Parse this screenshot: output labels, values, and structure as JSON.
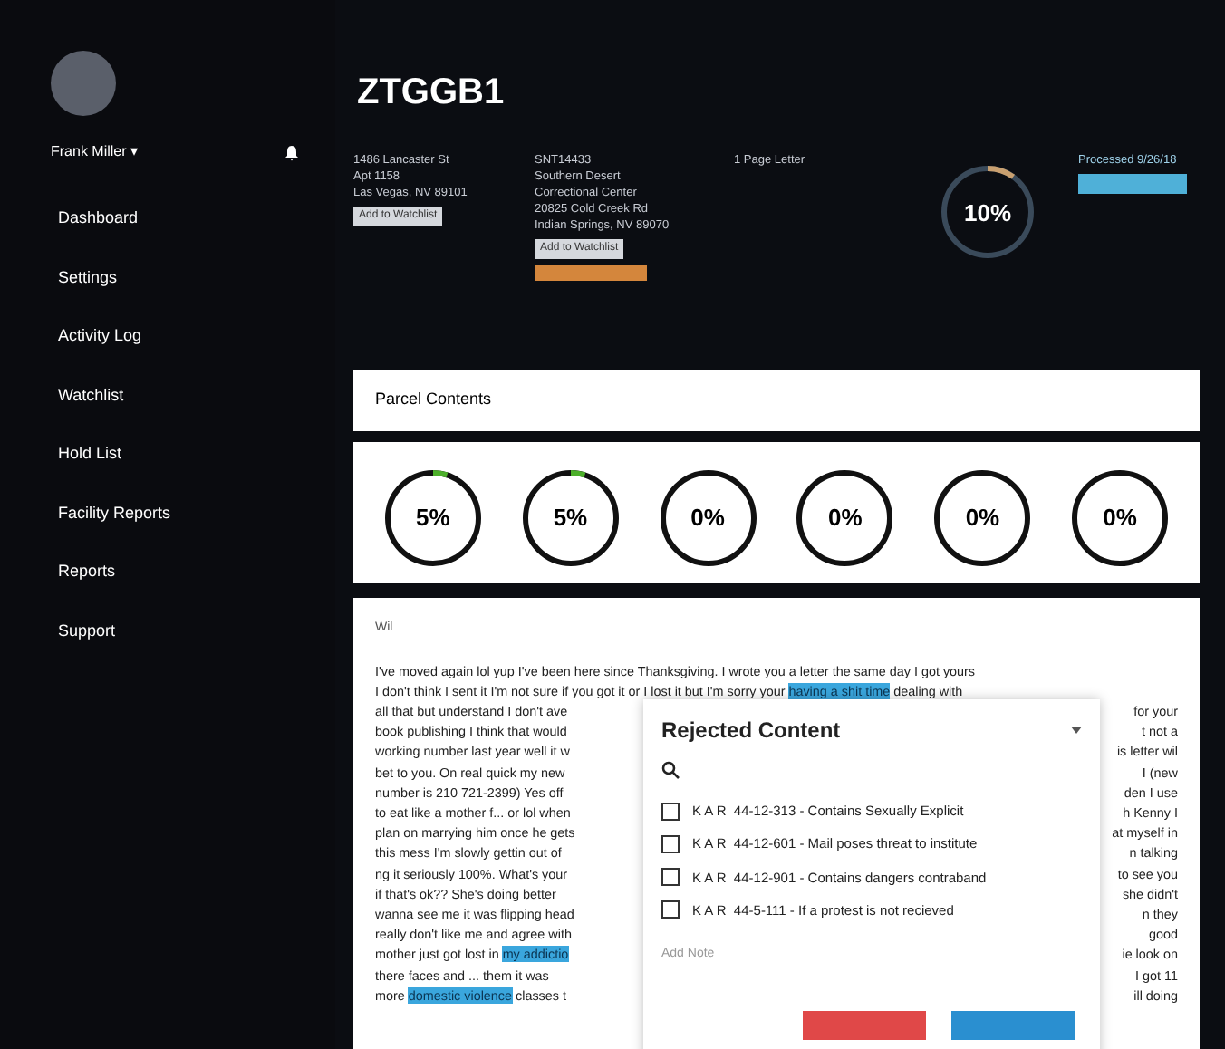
{
  "sidebar": {
    "user": "Frank Miller",
    "user_caret": "▾",
    "items": [
      {
        "label": "Dashboard",
        "selected": false
      },
      {
        "label": "Settings",
        "selected": false
      },
      {
        "label": "Activity Log",
        "selected": false
      },
      {
        "label": "Watchlist",
        "selected": false
      },
      {
        "label": "Hold List",
        "selected": false
      },
      {
        "label": "Facility Reports",
        "selected": false
      },
      {
        "label": "Reports",
        "selected": false
      },
      {
        "label": "Support",
        "selected": false
      }
    ]
  },
  "header": {
    "title": "ZTGGB1",
    "sender": {
      "lines": [
        "1486 Lancaster St",
        "Apt 1158",
        "Las Vegas, NV 89101"
      ],
      "button": "Add to Watchlist"
    },
    "recipient": {
      "lines": [
        "SNT14433",
        "Southern Desert",
        "Correctional Center",
        "20825 Cold Creek Rd",
        "Indian Springs, NV 89070"
      ],
      "button": "Add to Watchlist"
    },
    "category": "1 Page Letter",
    "threat": {
      "value": "10%",
      "level": 0.1
    },
    "processed": "Processed 9/26/18"
  },
  "parcel_contents": {
    "title": "Parcel Contents",
    "meters": [
      {
        "value": "5%",
        "level": 0.05
      },
      {
        "value": "5%",
        "level": 0.05
      },
      {
        "value": "0%",
        "level": 0
      },
      {
        "value": "0%",
        "level": 0
      },
      {
        "value": "0%",
        "level": 0
      },
      {
        "value": "0%",
        "level": 0
      }
    ]
  },
  "letter": {
    "greeting": "Wil",
    "lines": [
      {
        "left": [
          {
            "text": "I've moved again lol yup I've been here since Thanksgiving. I wrote you a letter the same day I got yours",
            "highlighted": false
          }
        ]
      },
      {
        "left": [
          {
            "text": "I don't think I sent it I'm not sure if you got it or I lost it but I'm sorry your ",
            "highlighted": false
          },
          {
            "text": "having a shit time",
            "highlighted": true
          },
          {
            "text": " dealing with",
            "highlighted": false
          }
        ]
      },
      {
        "left": [
          {
            "text": "all that but understand I don't ave",
            "highlighted": false
          }
        ],
        "right": "for your"
      },
      {
        "left": [
          {
            "text": "book publishing I think that would",
            "highlighted": false
          }
        ],
        "right": "t not a"
      },
      {
        "left": [
          {
            "text": "working number last year well it w",
            "highlighted": false
          }
        ],
        "right": "is letter wil"
      },
      {
        "left": [
          {
            "text": "bet to you. On real quick my new",
            "highlighted": false
          }
        ],
        "right": "I (new"
      },
      {
        "left": [
          {
            "text": "number is 210 721-2399) Yes off",
            "highlighted": false
          }
        ],
        "right": "den I use"
      },
      {
        "left": [
          {
            "text": "to eat like a mother f... or lol when",
            "highlighted": false
          }
        ],
        "right": "h Kenny I"
      },
      {
        "left": [
          {
            "text": "plan on marrying him once he gets",
            "highlighted": false
          }
        ],
        "right": "at myself in"
      },
      {
        "left": [
          {
            "text": "this mess I'm slowly gettin out of",
            "highlighted": false
          }
        ],
        "right": "n talking"
      },
      {
        "left": [
          {
            "text": "ng it seriously 100%. What's your",
            "highlighted": false
          }
        ],
        "right": "to see you"
      },
      {
        "left": [
          {
            "text": "if that's ok?? She's doing better",
            "highlighted": false
          }
        ],
        "right": "she didn't"
      },
      {
        "left": [
          {
            "text": "wanna see me it was flipping head",
            "highlighted": false
          }
        ],
        "right": "n they"
      },
      {
        "left": [
          {
            "text": "really don't like me and agree with",
            "highlighted": false
          }
        ],
        "right": "good"
      },
      {
        "left": [
          {
            "text": "mother just got lost in ",
            "highlighted": false
          },
          {
            "text": "my addictio",
            "highlighted": true
          }
        ],
        "right": "ie look on"
      },
      {
        "left": [
          {
            "text": "there faces and ... them it was",
            "highlighted": false
          }
        ],
        "right": "I got 11"
      },
      {
        "left": [
          {
            "text": "more ",
            "highlighted": false
          },
          {
            "text": "domestic violence",
            "highlighted": true
          },
          {
            "text": " classes t",
            "highlighted": false
          }
        ],
        "right": "ill doing"
      }
    ]
  },
  "modal": {
    "title": "Rejected Content",
    "reasons": [
      {
        "label": "K A R  44-12-313 - Contains Sexually Explicit",
        "checked": false
      },
      {
        "label": "K A R  44-12-601 - Mail poses threat to institute",
        "checked": false
      },
      {
        "label": "K A R  44-12-901 - Contains dangers contraband",
        "checked": false
      },
      {
        "label": "K A R  44-5-111 - If a protest is not recieved",
        "checked": false
      }
    ],
    "note_placeholder": "Add Note"
  }
}
